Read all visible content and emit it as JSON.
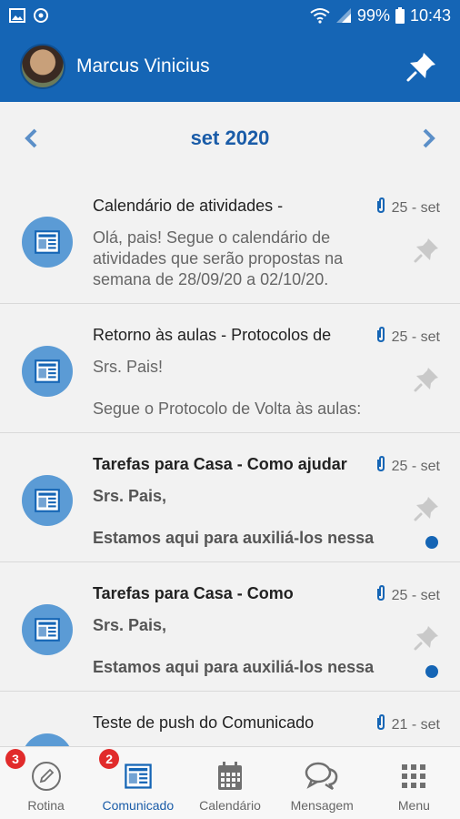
{
  "status_bar": {
    "battery": "99%",
    "time": "10:43"
  },
  "header": {
    "user_name": "Marcus Vinicius"
  },
  "month_nav": {
    "label": "set 2020"
  },
  "messages": [
    {
      "title": "Calendário de atividades -",
      "date": "25 - set",
      "body": "Olá, pais!  Segue o calendário de atividades que serão propostas na semana de 28/09/20 a 02/10/20.",
      "unread": false
    },
    {
      "title": "Retorno às aulas - Protocolos de",
      "date": "25 - set",
      "body": "Srs. Pais!\n\nSegue o Protocolo de Volta às aulas:",
      "unread": false
    },
    {
      "title": "Tarefas para Casa - Como ajudar",
      "date": "25 - set",
      "body": "Srs. Pais,\n\nEstamos aqui para auxiliá-los nessa",
      "unread": true
    },
    {
      "title": "Tarefas para Casa - Como",
      "date": "25 - set",
      "body": "Srs. Pais,\n\nEstamos aqui para auxiliá-los nessa",
      "unread": true
    },
    {
      "title": "Teste de push do Comunicado",
      "date": "21 - set",
      "body": "",
      "unread": false
    }
  ],
  "bottom_nav": [
    {
      "label": "Rotina",
      "badge": "3",
      "icon": "pencil-icon",
      "active": false
    },
    {
      "label": "Comunicado",
      "badge": "2",
      "icon": "newsletter-icon",
      "active": true
    },
    {
      "label": "Calendário",
      "badge": "",
      "icon": "calendar-icon",
      "active": false
    },
    {
      "label": "Mensagem",
      "badge": "",
      "icon": "chat-icon",
      "active": false
    },
    {
      "label": "Menu",
      "badge": "",
      "icon": "grid-icon",
      "active": false
    }
  ],
  "colors": {
    "primary": "#1565b5",
    "accent_text": "#1a5ca8",
    "badge": "#e12b2b",
    "item_icon_bg": "#5b9bd5"
  }
}
